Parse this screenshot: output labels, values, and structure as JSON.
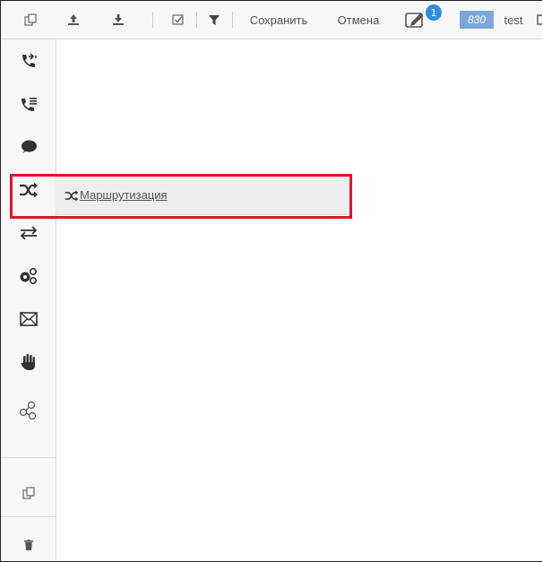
{
  "toolbar": {
    "save_label": "Сохранить",
    "cancel_label": "Отмена",
    "notification_count": "1",
    "extension": "830",
    "username": "test"
  },
  "sidebar": {
    "items": [
      {
        "icon": "phone-transfer-icon"
      },
      {
        "icon": "phone-list-icon"
      },
      {
        "icon": "chat-bubble-icon"
      },
      {
        "icon": "shuffle-icon",
        "active": true
      },
      {
        "icon": "exchange-arrows-icon"
      },
      {
        "icon": "gears-icon"
      },
      {
        "icon": "envelope-icon"
      },
      {
        "icon": "hand-stop-icon"
      },
      {
        "icon": "network-icon"
      },
      {
        "icon": "copy-icon"
      },
      {
        "icon": "trash-icon"
      }
    ]
  },
  "flyout": {
    "label": "Маршрутизация"
  },
  "colors": {
    "highlight": "#e0152a",
    "badge": "#2e8ee0",
    "extension_bg": "#7aa7d8",
    "icon_dark": "#333333"
  }
}
